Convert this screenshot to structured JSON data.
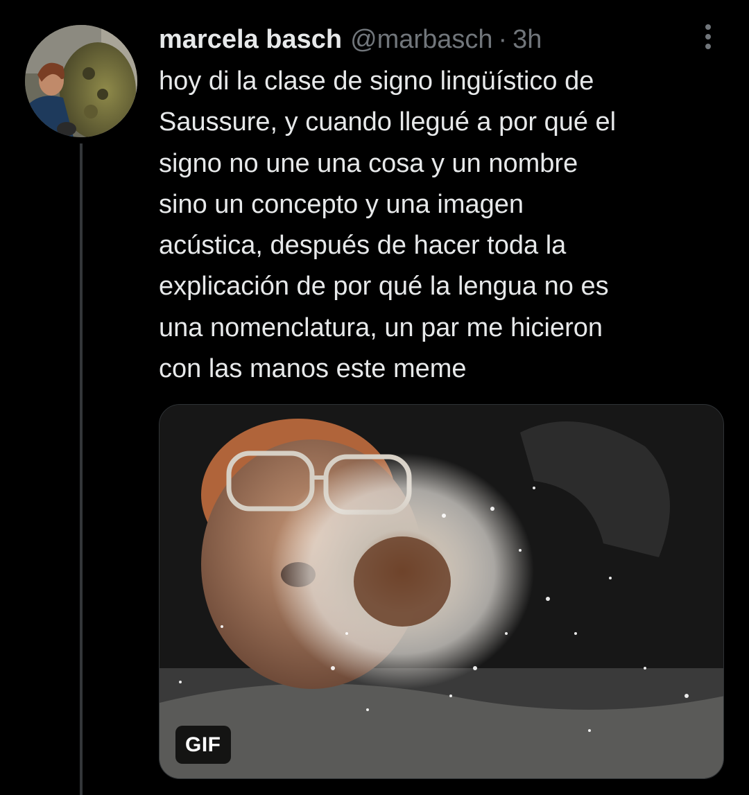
{
  "tweet": {
    "display_name": "marcela basch",
    "handle": "@marbasch",
    "separator": "·",
    "time": "3h",
    "text": "hoy di la clase de signo lingüístico de\nSaussure, y cuando llegué a por qué el\nsigno no une una cosa y un nombre\nsino un concepto y una imagen\nacústica, después de hacer toda la\nexplicación de por qué la lengua no es\nuna nomenclatura, un par me hicieron\ncon las manos este meme",
    "more_icon": "more-dots-icon",
    "media": {
      "type": "gif",
      "badge": "GIF"
    }
  },
  "colors": {
    "background": "#000000",
    "text_primary": "#e7e9ea",
    "text_secondary": "#71767b",
    "thread_line": "#333639"
  }
}
